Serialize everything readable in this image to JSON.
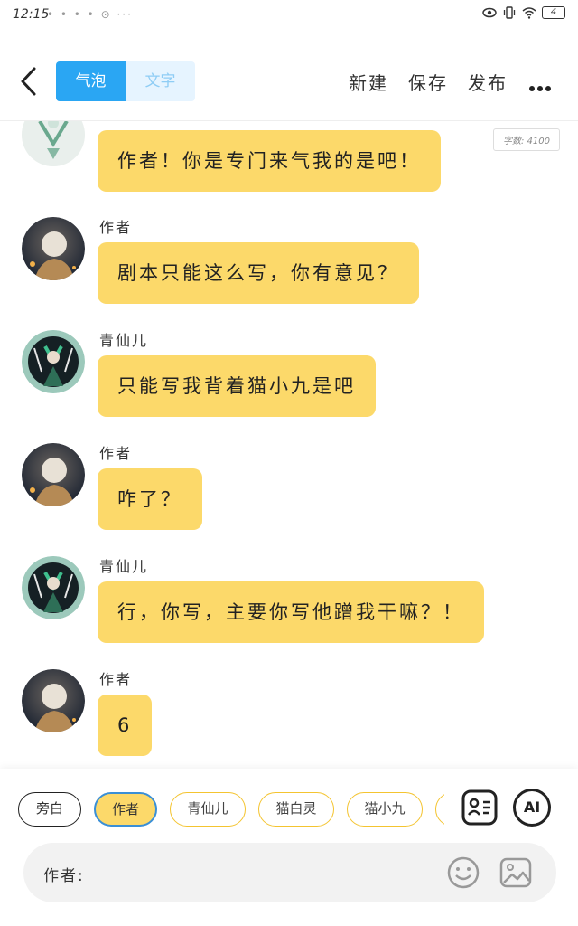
{
  "status_bar": {
    "time": "12:15",
    "notification_dots": "• • • • ⊙ ···",
    "battery": "4"
  },
  "header": {
    "tabs": [
      {
        "label": "气泡",
        "active": true
      },
      {
        "label": "文字",
        "active": false
      }
    ],
    "actions": [
      "新建",
      "保存",
      "发布"
    ],
    "more_icon": "more-dots-icon",
    "back_icon": "chevron-left-icon"
  },
  "word_count": "字数: 4100",
  "messages": [
    {
      "speaker": "",
      "text": "作者！你是专门来气我的是吧！",
      "avatar": "green-fairy-avatar-partial"
    },
    {
      "speaker": "作者",
      "text": "剧本只能这么写，你有意见？",
      "avatar": "author-avatar"
    },
    {
      "speaker": "青仙儿",
      "text": "只能写我背着猫小九是吧",
      "avatar": "qingxianer-avatar"
    },
    {
      "speaker": "作者",
      "text": "咋了？",
      "avatar": "author-avatar"
    },
    {
      "speaker": "青仙儿",
      "text": "行，你写，主要你写他蹭我干嘛？！",
      "avatar": "qingxianer-avatar"
    },
    {
      "speaker": "作者",
      "text": "6",
      "avatar": "author-avatar"
    }
  ],
  "characters": [
    "旁白",
    "作者",
    "青仙儿",
    "猫白灵",
    "猫小九",
    ""
  ],
  "selected_character": "作者",
  "tools": {
    "roles_icon": "character-card-icon",
    "ai_label": "AI"
  },
  "input": {
    "label": "作者:",
    "value": "",
    "placeholder": ""
  },
  "input_icons": [
    "emoji-icon",
    "image-icon"
  ],
  "colors": {
    "accent": "#2aa6f3",
    "bubble": "#fcd96a"
  }
}
